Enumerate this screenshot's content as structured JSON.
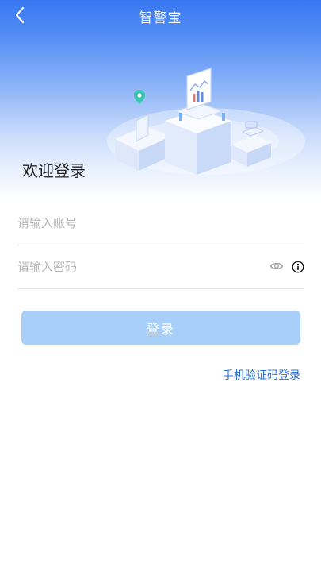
{
  "header": {
    "title": "智警宝",
    "back_icon": "chevron-left-icon"
  },
  "hero": {
    "welcome_text": "欢迎登录",
    "illustration": "isometric-devices-illustration"
  },
  "form": {
    "account_placeholder": "请输入账号",
    "account_value": "",
    "password_placeholder": "请输入密码",
    "password_value": "",
    "eye_icon": "eye-icon",
    "info_icon": "info-icon"
  },
  "actions": {
    "login_label": "登录",
    "sms_login_label": "手机验证码登录"
  },
  "colors": {
    "header_blue": "#3a78f2",
    "button_bg": "#a8cff8",
    "link_blue": "#2b6fd6"
  }
}
